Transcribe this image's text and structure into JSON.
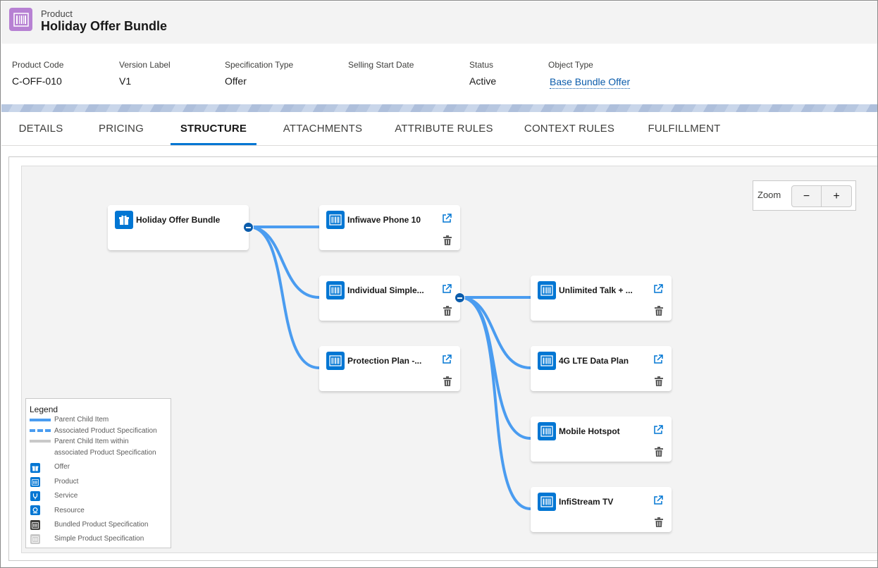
{
  "header": {
    "object_type": "Product",
    "title": "Holiday Offer Bundle",
    "icon": "product-barcode-icon",
    "icon_color": "#b781d3"
  },
  "highlights": [
    {
      "label": "Product Code",
      "value": "C-OFF-010"
    },
    {
      "label": "Version Label",
      "value": "V1"
    },
    {
      "label": "Specification Type",
      "value": "Offer"
    },
    {
      "label": "Selling Start Date",
      "value": ""
    },
    {
      "label": "Status",
      "value": "Active"
    },
    {
      "label": "Object Type",
      "value": "Base Bundle Offer"
    }
  ],
  "tabs": [
    {
      "label": "DETAILS",
      "active": false
    },
    {
      "label": "PRICING",
      "active": false
    },
    {
      "label": "STRUCTURE",
      "active": true
    },
    {
      "label": "ATTACHMENTS",
      "active": false
    },
    {
      "label": "ATTRIBUTE RULES",
      "active": false
    },
    {
      "label": "CONTEXT RULES",
      "active": false
    },
    {
      "label": "FULFILLMENT",
      "active": false
    }
  ],
  "zoom": {
    "label": "Zoom",
    "minus": "−",
    "plus": "+"
  },
  "colors": {
    "accent": "#0176d3",
    "link": "#4a9cf0",
    "active_tab": "#0176d3"
  },
  "nodes": [
    {
      "label": "Holiday Offer Bundle",
      "icon": "gift-icon",
      "kind": "Offer"
    },
    {
      "label": "Infiwave Phone 10",
      "icon": "barcode-icon",
      "kind": "Product"
    },
    {
      "label": "Individual Simple...",
      "icon": "barcode-icon",
      "kind": "Product"
    },
    {
      "label": "Protection Plan -...",
      "icon": "barcode-icon",
      "kind": "Product"
    },
    {
      "label": "Unlimited Talk + ...",
      "icon": "barcode-icon",
      "kind": "Product"
    },
    {
      "label": "4G LTE Data Plan",
      "icon": "barcode-icon",
      "kind": "Product"
    },
    {
      "label": "Mobile Hotspot",
      "icon": "barcode-icon",
      "kind": "Product"
    },
    {
      "label": "InfiStream TV",
      "icon": "barcode-icon",
      "kind": "Product"
    }
  ],
  "legend": {
    "title": "Legend",
    "lines": [
      {
        "label": "Parent Child Item",
        "style": "solid",
        "color": "#4a9cf0"
      },
      {
        "label": "Associated Product Specification",
        "style": "dashed",
        "color": "#4a9cf0"
      },
      {
        "label": "Parent Child Item within",
        "label2": "associated Product Specification",
        "style": "solid",
        "color": "#c9c9c9"
      }
    ],
    "icons": [
      {
        "label": "Offer",
        "icon": "gift-icon",
        "color": "#0176d3"
      },
      {
        "label": "Product",
        "icon": "barcode-icon",
        "color": "#0176d3"
      },
      {
        "label": "Service",
        "icon": "service-icon",
        "color": "#0176d3"
      },
      {
        "label": "Resource",
        "icon": "resource-icon",
        "color": "#0176d3"
      },
      {
        "label": "Bundled Product Specification",
        "icon": "barcode-icon",
        "color": "#3e3e3c"
      },
      {
        "label": "Simple Product Specification",
        "icon": "barcode-icon",
        "color": "#c9c9c9"
      }
    ]
  }
}
